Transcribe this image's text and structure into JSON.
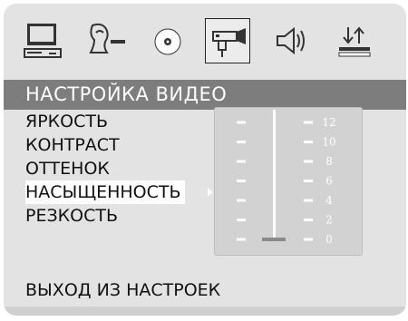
{
  "icon_bar": {
    "icons": [
      {
        "name": "monitor-icon"
      },
      {
        "name": "language-icon"
      },
      {
        "name": "disc-icon"
      },
      {
        "name": "video-camera-icon",
        "selected": true
      },
      {
        "name": "speaker-icon"
      },
      {
        "name": "preference-icon"
      }
    ]
  },
  "section": {
    "title": "НАСТРОЙКА ВИДЕО"
  },
  "options": [
    {
      "label": "ЯРКОСТЬ"
    },
    {
      "label": "КОНТРАСТ"
    },
    {
      "label": "ОТТЕНОК"
    },
    {
      "label": "НАСЫЩЕННОСТЬ",
      "active": true
    },
    {
      "label": "РЕЗКОСТЬ"
    }
  ],
  "scale": {
    "ticks": [
      "12",
      "10",
      "8",
      "6",
      "4",
      "2",
      "0"
    ],
    "current_value": 0,
    "min": 0,
    "max": 12
  },
  "footer": {
    "exit_label": "ВЫХОД ИЗ НАСТРОЕК"
  },
  "colors": {
    "header_bar": "#7d7d7d",
    "background": "#e3e3e3",
    "panel": "#d2d2d2",
    "text": "#111111"
  }
}
